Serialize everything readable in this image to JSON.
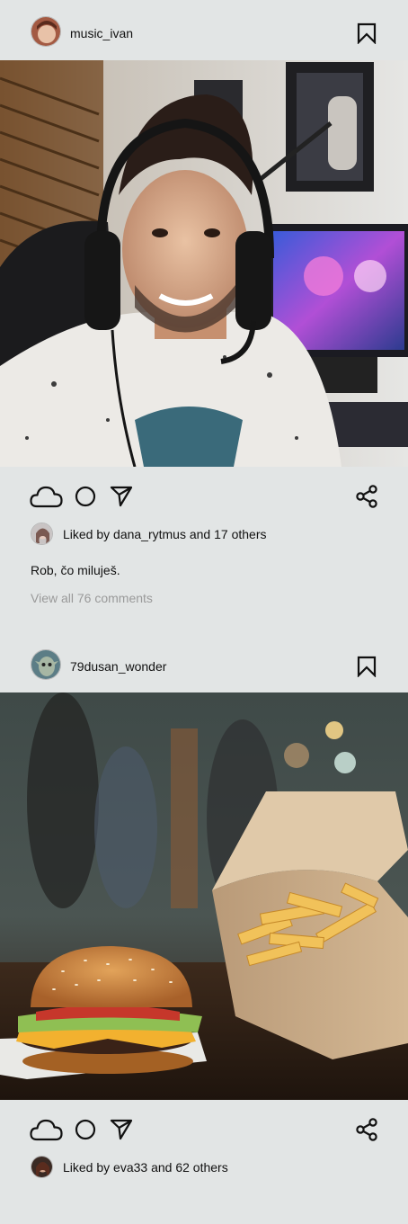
{
  "posts": [
    {
      "username": "music_ivan",
      "avatar_icon": "user-avatar",
      "photo_alt": "",
      "likes_text": "Liked by dana_rytmus and 17 others",
      "caption": "Rob, čo miluješ.",
      "view_comments": "View all 76 comments"
    },
    {
      "username": "79dusan_wonder",
      "avatar_icon": "user-avatar",
      "photo_alt": "",
      "likes_text": "Liked by eva33 and 62 others"
    }
  ],
  "icons": {
    "like": "cloud-icon",
    "comment": "circle-icon",
    "send": "send-icon",
    "share": "share-icon",
    "bookmark": "bookmark-icon"
  },
  "colors": {
    "background": "#e2e5e5",
    "text": "#111111",
    "muted": "#9a9a9a"
  }
}
